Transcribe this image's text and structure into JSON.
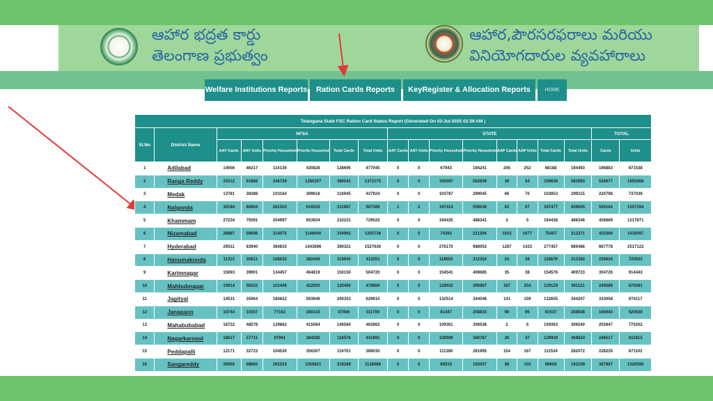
{
  "header": {
    "left_title_line1": "ఆహార భద్రత కార్డు",
    "left_title_line2": "తెలంగాణ ప్రభుత్వం",
    "right_title_line1": "ఆహార,పౌరసరఫరాలు మరియు",
    "right_title_line2": "వినియోగదారుల వ్యవహారాలు"
  },
  "nav": {
    "welfare": "Welfare Institutions Reports",
    "ration": "Ration Cards Reports",
    "keyregister": "KeyRegister & Allocation Reports",
    "home": "HOME"
  },
  "colors": {
    "band": "#6fc46b",
    "header_bg": "#9fd79a",
    "teal": "#1e8f8a",
    "stripe": "#66c2c2",
    "arrow": "#e03a3a"
  },
  "table": {
    "title": "Telangana State FSC Ration Card Status Report (Generated On 03-Jul-2025 02:39 AM )",
    "groups": {
      "nfsa": "NFSA",
      "state": "STATE",
      "total": "TOTAL"
    },
    "col_slno": "Sl.No",
    "col_district": "District Name",
    "nfsa_cols": [
      "AAY Cards",
      "AAY Units",
      "Priority Household cards",
      "Priority Household Units",
      "Total Cards",
      "Total Units"
    ],
    "state_cols": [
      "AAY Cards",
      "AAY Units",
      "Priority Household Cards",
      "Priority Household Units",
      "AAP Cards",
      "AAP Units",
      "Total Cards",
      "Total Units"
    ],
    "total_cols": [
      "Cards",
      "Units"
    ],
    "rows": [
      [
        "1",
        "Adilabad",
        "14556",
        "46217",
        "114139",
        "430828",
        "128695",
        "477045",
        "0",
        "0",
        "67943",
        "194241",
        "245",
        "252",
        "68188",
        "194493",
        "196883",
        "671538"
      ],
      [
        "2",
        "Ranga Reddy",
        "33312",
        "91868",
        "346729",
        "1280307",
        "380041",
        "1372175",
        "0",
        "0",
        "156597",
        "582839",
        "39",
        "54",
        "156636",
        "582893",
        "536677",
        "1955068"
      ],
      [
        "3",
        "Medak",
        "13781",
        "38388",
        "103164",
        "399616",
        "116945",
        "437924",
        "0",
        "0",
        "103787",
        "299045",
        "66",
        "70",
        "103853",
        "299115",
        "220798",
        "737039"
      ],
      [
        "4",
        "Nalgonda",
        "30184",
        "80854",
        "281503",
        "916535",
        "311687",
        "997389",
        "1",
        "2",
        "197414",
        "559036",
        "62",
        "67",
        "197477",
        "559605",
        "509164",
        "1557294"
      ],
      [
        "5",
        "Khammam",
        "27234",
        "75591",
        "204997",
        "653934",
        "232231",
        "729525",
        "0",
        "0",
        "194435",
        "488341",
        "3",
        "5",
        "194438",
        "488346",
        "426669",
        "1217871"
      ],
      [
        "6",
        "Nizamabad",
        "28887",
        "59696",
        "314075",
        "1146040",
        "334962",
        "1205736",
        "0",
        "0",
        "74392",
        "211294",
        "1015",
        "1077",
        "75407",
        "212371",
        "410369",
        "1418097"
      ],
      [
        "7",
        "Hyderabad",
        "29511",
        "83940",
        "360810",
        "1443696",
        "390321",
        "1527636",
        "0",
        "0",
        "276170",
        "988053",
        "1287",
        "1433",
        "277457",
        "989486",
        "667778",
        "2517122"
      ],
      [
        "8",
        "Hanumakonda",
        "11313",
        "30811",
        "108632",
        "382440",
        "119945",
        "413251",
        "0",
        "0",
        "118655",
        "312354",
        "24",
        "28",
        "118679",
        "312382",
        "238624",
        "725633"
      ],
      [
        "9",
        "Karimnagar",
        "15693",
        "39901",
        "134457",
        "464819",
        "150150",
        "504720",
        "0",
        "0",
        "154541",
        "409685",
        "35",
        "38",
        "154576",
        "409723",
        "304726",
        "914443"
      ],
      [
        "10",
        "Mahbubnagar",
        "19914",
        "56032",
        "101446",
        "422920",
        "120460",
        "478960",
        "0",
        "0",
        "128932",
        "390867",
        "187",
        "254",
        "129129",
        "391121",
        "249589",
        "870081"
      ],
      [
        "11",
        "Jagityal",
        "14531",
        "35964",
        "185822",
        "593946",
        "200353",
        "629910",
        "0",
        "0",
        "132514",
        "344048",
        "141",
        "159",
        "132655",
        "344207",
        "333008",
        "974117"
      ],
      [
        "12",
        "Janagaon",
        "10744",
        "31557",
        "77162",
        "280143",
        "87906",
        "311700",
        "0",
        "0",
        "81447",
        "208833",
        "90",
        "95",
        "81537",
        "208928",
        "169443",
        "520629"
      ],
      [
        "13",
        "Mahabubabad",
        "16722",
        "48578",
        "129862",
        "415084",
        "146584",
        "463662",
        "0",
        "0",
        "109361",
        "306538",
        "2",
        "5",
        "109363",
        "306540",
        "255947",
        "770202"
      ],
      [
        "14",
        "Nagarkarnool",
        "18617",
        "57711",
        "97961",
        "384280",
        "116578",
        "441991",
        "0",
        "0",
        "129909",
        "369787",
        "30",
        "37",
        "129939",
        "369824",
        "246517",
        "811815"
      ],
      [
        "15",
        "Peddapalli",
        "12171",
        "32723",
        "104530",
        "356307",
        "116701",
        "389030",
        "0",
        "0",
        "111380",
        "281995",
        "154",
        "167",
        "111534",
        "282072",
        "228235",
        "671102"
      ],
      [
        "16",
        "Sangareddy",
        "26065",
        "68665",
        "292224",
        "1059821",
        "318289",
        "1128486",
        "0",
        "0",
        "69510",
        "192007",
        "98",
        "102",
        "69608",
        "192109",
        "387897",
        "1320595"
      ]
    ]
  }
}
